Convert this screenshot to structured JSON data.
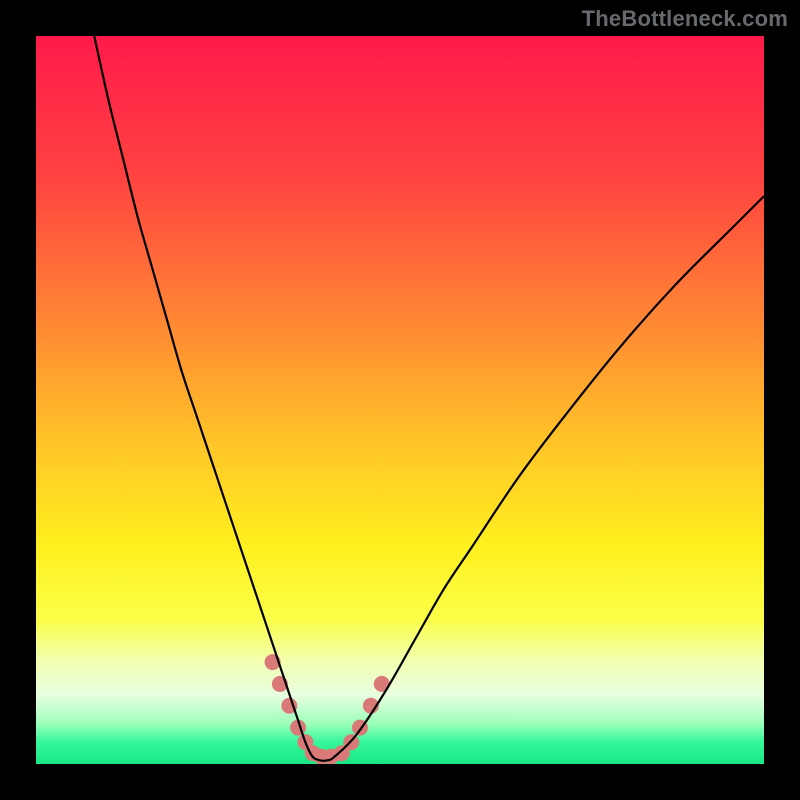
{
  "watermark": "TheBottleneck.com",
  "chart_data": {
    "type": "line",
    "title": "",
    "xlabel": "",
    "ylabel": "",
    "xlim": [
      0,
      100
    ],
    "ylim": [
      0,
      100
    ],
    "grid": false,
    "legend": false,
    "gradient_stops": [
      {
        "offset": 0.0,
        "color": "#ff1a4b"
      },
      {
        "offset": 0.2,
        "color": "#ff4440"
      },
      {
        "offset": 0.4,
        "color": "#ff8a33"
      },
      {
        "offset": 0.55,
        "color": "#ffc128"
      },
      {
        "offset": 0.7,
        "color": "#fff01e"
      },
      {
        "offset": 0.8,
        "color": "#fbff47"
      },
      {
        "offset": 0.86,
        "color": "#f2ffb2"
      },
      {
        "offset": 0.905,
        "color": "#e8ffe0"
      },
      {
        "offset": 0.945,
        "color": "#9bffba"
      },
      {
        "offset": 0.97,
        "color": "#35f79b"
      },
      {
        "offset": 1.0,
        "color": "#17e884"
      }
    ],
    "series": [
      {
        "name": "bottleneck-curve",
        "color": "#000000",
        "width": 2.2,
        "x": [
          8,
          10,
          12,
          14,
          16,
          18,
          20,
          22,
          24,
          26,
          28,
          30,
          32,
          34,
          36,
          37,
          38,
          39,
          40,
          41,
          44,
          48,
          52,
          56,
          60,
          66,
          72,
          80,
          88,
          96,
          100
        ],
        "y": [
          100,
          91,
          83,
          75,
          68,
          61,
          54,
          48,
          42,
          36,
          30,
          24,
          18,
          12,
          6,
          3,
          1,
          0.5,
          0.5,
          1,
          4,
          10,
          17,
          24,
          30,
          39,
          47,
          57,
          66,
          74,
          78
        ]
      },
      {
        "name": "highlight-dots-left",
        "type": "scatter",
        "color": "#d97a78",
        "radius": 8,
        "x": [
          32.5,
          33.5,
          34.8,
          36.0,
          37.0,
          38.0,
          39.2,
          40.5
        ],
        "y": [
          14,
          11,
          8,
          5,
          3,
          1.5,
          1,
          1
        ]
      },
      {
        "name": "highlight-dots-right",
        "type": "scatter",
        "color": "#d97a78",
        "radius": 8,
        "x": [
          42.0,
          43.3,
          44.5,
          46.0,
          47.5
        ],
        "y": [
          1.5,
          3,
          5,
          8,
          11
        ]
      }
    ]
  }
}
